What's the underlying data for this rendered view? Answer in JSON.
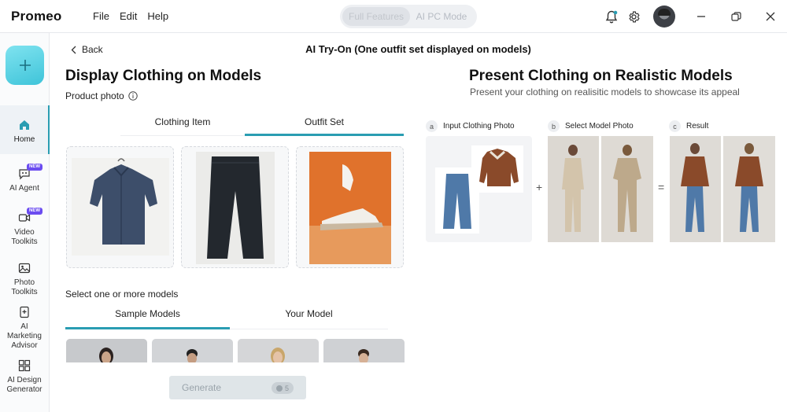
{
  "app": {
    "name": "Promeo"
  },
  "menu": {
    "file": "File",
    "edit": "Edit",
    "help": "Help"
  },
  "mode_toggle": {
    "full": "Full Features",
    "ai_pc": "AI PC Mode"
  },
  "sidebar": {
    "items": [
      {
        "label": "Home",
        "active": true,
        "badge": ""
      },
      {
        "label": "AI Agent",
        "badge": "NEW"
      },
      {
        "label": "Video Toolkits",
        "badge": "NEW"
      },
      {
        "label": "Photo Toolkits",
        "badge": ""
      },
      {
        "label": "AI Marketing Advisor",
        "badge": ""
      },
      {
        "label": "AI Design Generator",
        "badge": ""
      }
    ]
  },
  "main": {
    "back": "Back",
    "title": "AI Try-On (One outfit set displayed on models)"
  },
  "left_panel": {
    "heading": "Display Clothing on Models",
    "product_photo_label": "Product photo",
    "tabs": [
      "Clothing Item",
      "Outfit Set"
    ],
    "active_tab": "Outfit Set",
    "select_models_label": "Select one or more models",
    "model_tabs": [
      "Sample Models",
      "Your Model"
    ],
    "active_model_tab": "Sample Models",
    "generate_label": "Generate",
    "generate_credits": "5"
  },
  "right_panel": {
    "heading": "Present Clothing on Realistic Models",
    "subheading": "Present your clothing on realisitic models to showcase its appeal",
    "steps": [
      {
        "letter": "a",
        "label": "Input Clothing Photo"
      },
      {
        "letter": "b",
        "label": "Select Model Photo"
      },
      {
        "letter": "c",
        "label": "Result"
      }
    ],
    "plus": "+",
    "equals": "="
  },
  "colors": {
    "accent": "#2a9db2",
    "add_button": "#3fc4d9",
    "badge": "#6b4cf0"
  }
}
